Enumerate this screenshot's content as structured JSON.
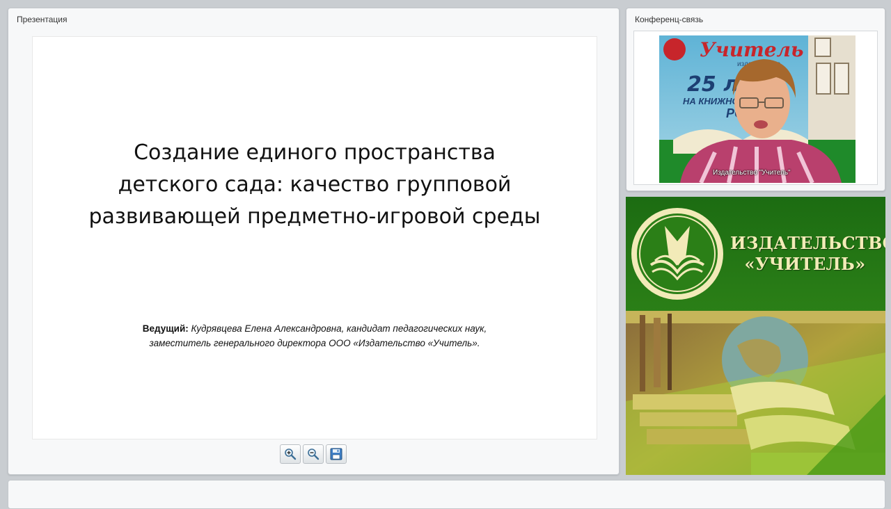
{
  "presentation": {
    "panel_title": "Презентация",
    "slide": {
      "title_lines": [
        "Создание единого пространства",
        "детского сада: качество групповой",
        "развивающей предметно-игровой среды"
      ],
      "presenter_label": "Ведущий:",
      "presenter_line1": " Кудрявцева Елена Александровна, кандидат педагогических наук,",
      "presenter_line2": "заместитель генерального директора ООО «Издательство «Учитель»."
    },
    "toolbar": [
      {
        "name": "zoom-in-button",
        "icon": "zoom-in-icon"
      },
      {
        "name": "zoom-out-button",
        "icon": "zoom-out-icon"
      },
      {
        "name": "save-button",
        "icon": "floppy-disk-icon"
      }
    ]
  },
  "conference": {
    "panel_title": "Конференц-связь",
    "video_label": "Издательство \"Учитель\"",
    "backdrop_text": {
      "brand": "Учитель",
      "line2": "издательство",
      "line3": "25 л",
      "line4": "НА КНИЖНО",
      "line5": "РО"
    }
  },
  "banner": {
    "line1": "ИЗДАТЕЛЬСТВО",
    "line2": "«УЧИТЕЛЬ»"
  },
  "colors": {
    "brand_green": "#2b7f17",
    "banner_text": "#f3ecb8",
    "panel_bg": "#f7f8f9",
    "page_bg": "#c9cdd1"
  }
}
